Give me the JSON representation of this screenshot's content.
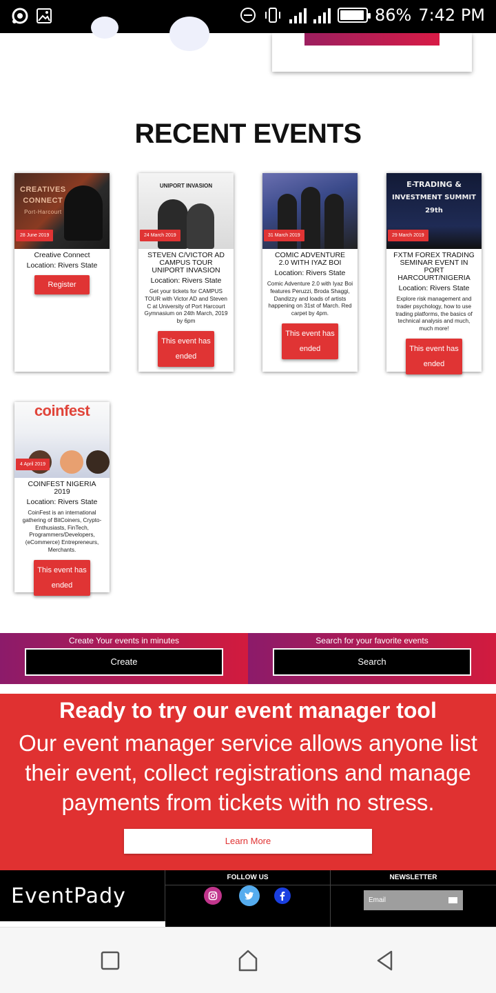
{
  "status_bar": {
    "battery": "86%",
    "time": "7:42 PM",
    "icons": [
      "camera-shutter-icon",
      "image-icon",
      "dnd-icon",
      "vibrate-icon",
      "signal-icon",
      "battery-icon"
    ]
  },
  "recent_events": {
    "heading": "RECENT EVENTS",
    "cards": [
      {
        "date": "28 June 2019",
        "thumb_text": [
          "CREATIVES",
          "CONNECT",
          "Port-Harcourt"
        ],
        "title": "Creative Connect",
        "location": "Location: Rivers State",
        "description": "",
        "button": "Register"
      },
      {
        "date": "24 March 2019",
        "thumb_text": [
          "UNIPORT INVASION"
        ],
        "title": "STEVEN C/VICTOR AD CAMPUS TOUR UNIPORT INVASION",
        "location": "Location: Rivers State",
        "description": "Get your tickets for CAMPUS TOUR with Victor AD and Steven C at University of Port Harcourt Gymnasium on 24th March, 2019 by 6pm",
        "button": "This event has ended"
      },
      {
        "date": "31 March 2019",
        "thumb_text": [],
        "title": "COMIC ADVENTURE 2.0 WITH IYAZ BOI",
        "location": "Location: Rivers State",
        "description": "Comic Adventure 2.0 with Iyaz Boi features Peruzzi, Broda Shaggi, Dandizzy and loads of artists happening on 31st of March. Red carpet by 4pm.",
        "button": "This event has ended"
      },
      {
        "date": "29 March 2019",
        "thumb_text": [
          "E-TRADING &",
          "INVESTMENT SUMMIT 29th"
        ],
        "title": "FXTM FOREX TRADING SEMINAR EVENT IN PORT HARCOURT/NIGERIA",
        "location": "Location: Rivers State",
        "description": "Explore risk management and trader psychology, how to use trading platforms, the basics of technical analysis and much, much more!",
        "button": "This event has ended"
      },
      {
        "date": "4 April 2019",
        "thumb_text": [
          "coinfest"
        ],
        "title": "COINFEST NIGERIA 2019",
        "location": "Location: Rivers State",
        "description": "CoinFest is an international gathering of BitCoiners, Crypto-Enthusiasts, FinTech, Programmers/Developers, (eCommerce) Entrepreneurs, Merchants.",
        "button": "This event has ended"
      }
    ]
  },
  "cta": {
    "create_label": "Create Your events in minutes",
    "create_button": "Create",
    "search_label": "Search for your favorite events",
    "search_button": "Search"
  },
  "promo": {
    "title": "Ready to try our event manager tool",
    "body": "Our event manager service allows anyone list their event, collect registrations and manage payments from tickets with no stress.",
    "button": "Learn More"
  },
  "footer": {
    "brand": "EventPady",
    "follow_caption": "FOLLOW US",
    "newsletter_caption": "NEWSLETTER",
    "email_placeholder": "Email",
    "social": [
      {
        "name": "instagram-icon",
        "color": "#c1358c"
      },
      {
        "name": "twitter-icon",
        "color": "#55acee"
      },
      {
        "name": "facebook-icon",
        "color": "#1a3fe0"
      }
    ]
  },
  "colors": {
    "accent_red": "#e03131",
    "gradient_start": "#8c1b6a",
    "gradient_end": "#d21b3e"
  }
}
